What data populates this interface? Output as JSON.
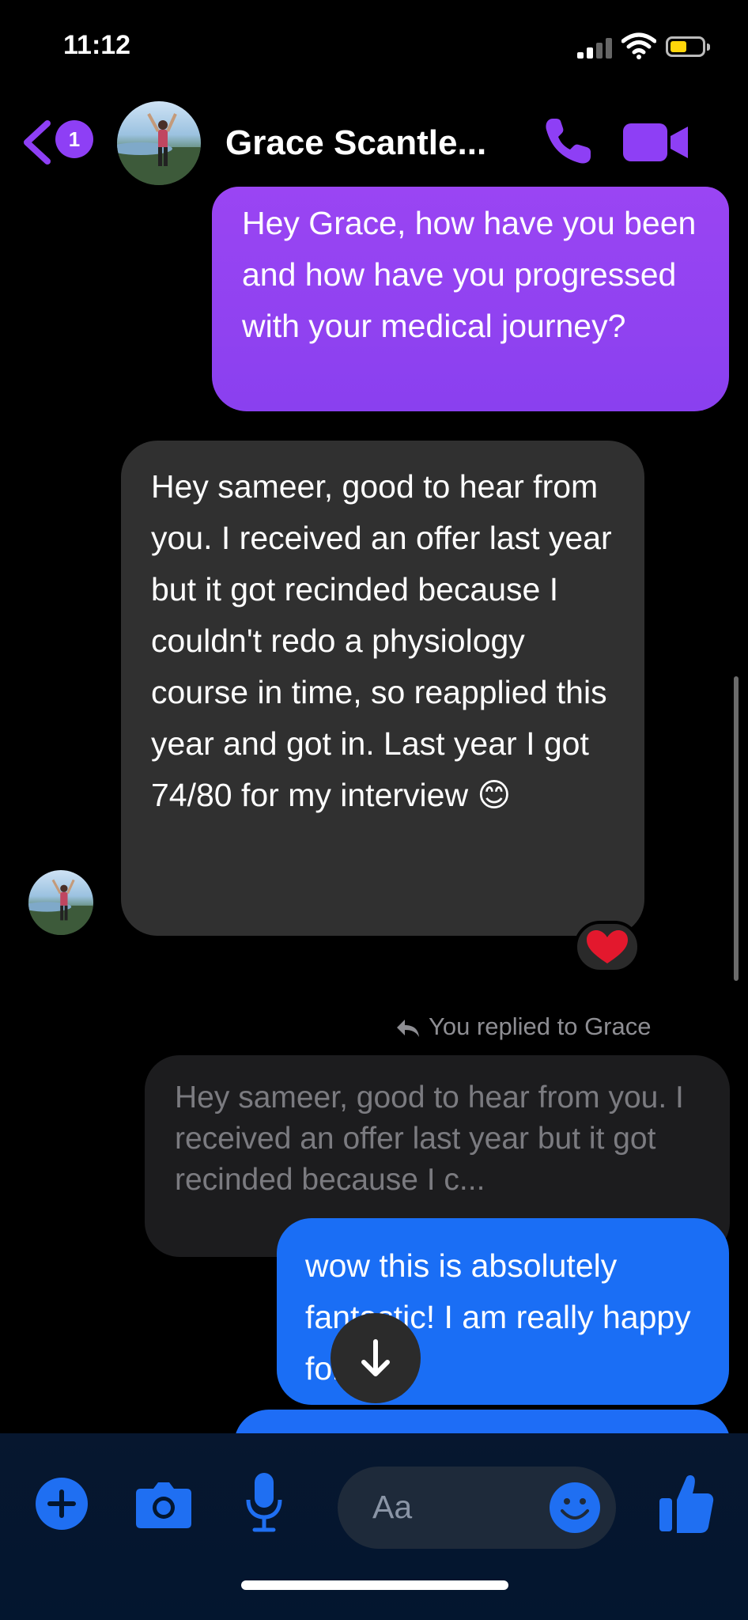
{
  "status": {
    "time": "11:12"
  },
  "header": {
    "unread_count": "1",
    "contact_name": "Grace Scantle..."
  },
  "messages": [
    {
      "id": "m1",
      "sender": "me",
      "text": "Hey Grace, how have you been and how have you progressed with your medical journey?"
    },
    {
      "id": "m2",
      "sender": "Grace",
      "text": "Hey sameer, good to hear from you.  I received an offer last year but it got recinded because I couldn't redo a physiology course in time, so reapplied this year and got in.  Last year I got 74/80 for my interview 😊",
      "reaction": "❤️"
    }
  ],
  "reply": {
    "meta": "You replied to Grace",
    "quoted_text": "Hey sameer, good to hear from you.  I received an offer last year but it got recinded because I c...",
    "text": "wow this is absolutely fantastic! I am really happy for you"
  },
  "composer": {
    "placeholder": "Aa"
  },
  "colors": {
    "purple": "#8e3ff5",
    "blue": "#1f6ff2",
    "incoming_bubble": "#303030"
  }
}
